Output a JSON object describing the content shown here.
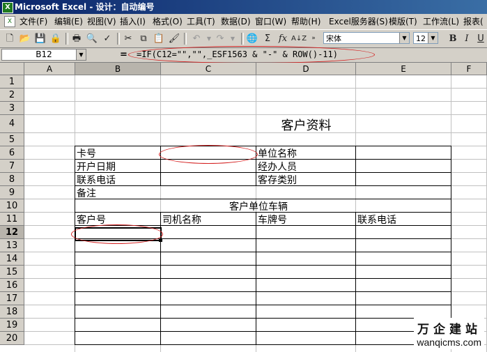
{
  "window": {
    "title": "Microsoft Excel - 设计：自动编号"
  },
  "menu": {
    "items": [
      "文件(F)",
      "编辑(E)",
      "视图(V)",
      "插入(I)",
      "格式(O)",
      "工具(T)",
      "数据(D)",
      "窗口(W)",
      "帮助(H)",
      "Excel服务器(S)",
      "模版(T)",
      "工作流(L)",
      "报表("
    ]
  },
  "toolbar": {
    "font_name": "宋体",
    "font_size": "12",
    "bold": "B",
    "italic": "I",
    "underline": "U",
    "sum": "Σ",
    "fx": "fx"
  },
  "formula_bar": {
    "name_box": "B12",
    "equals": "=",
    "formula": "=IF(C12=\"\",\"\",_ESF1563 & \"-\" & ROW()-11)"
  },
  "sheet": {
    "columns": [
      "A",
      "B",
      "C",
      "D",
      "E",
      "F"
    ],
    "rows": [
      "1",
      "2",
      "3",
      "4",
      "5",
      "6",
      "7",
      "8",
      "9",
      "10",
      "11",
      "12",
      "13",
      "14",
      "15",
      "16",
      "17",
      "18",
      "19",
      "20"
    ],
    "active_cell": "B12",
    "cells": {
      "title": "客户资料",
      "card_no": "卡号",
      "unit_name": "单位名称",
      "open_date": "开户日期",
      "handler": "经办人员",
      "phone": "联系电话",
      "deposit_type": "客存类别",
      "remark": "备注",
      "vehicles": "客户单位车辆",
      "customer_no": "客户号",
      "driver_name": "司机名称",
      "plate_no": "车牌号",
      "phone2": "联系电话"
    }
  },
  "watermark": {
    "line1": "万企建站",
    "line2": "wanqicms.com"
  }
}
